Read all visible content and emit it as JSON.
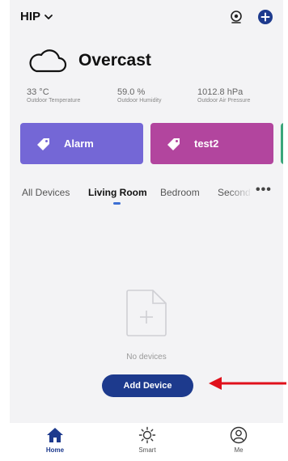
{
  "header": {
    "home_name": "HIP"
  },
  "weather": {
    "condition": "Overcast",
    "stats": [
      {
        "value": "33 °C",
        "label": "Outdoor Temperature"
      },
      {
        "value": "59.0 %",
        "label": "Outdoor Humidity"
      },
      {
        "value": "1012.8 hPa",
        "label": "Outdoor Air Pressure"
      }
    ]
  },
  "scenes": [
    {
      "label": "Alarm",
      "color": "#7467d6"
    },
    {
      "label": "test2",
      "color": "#b2459e"
    }
  ],
  "rooms": {
    "tabs": [
      "All Devices",
      "Living Room",
      "Bedroom",
      "Second"
    ],
    "selected": "Living Room"
  },
  "empty_state": {
    "message": "No devices",
    "button": "Add Device"
  },
  "tabbar": {
    "items": [
      "Home",
      "Smart",
      "Me"
    ],
    "selected": "Home"
  },
  "colors": {
    "accent": "#1d3a8d",
    "annotation_arrow": "#e0101b"
  }
}
